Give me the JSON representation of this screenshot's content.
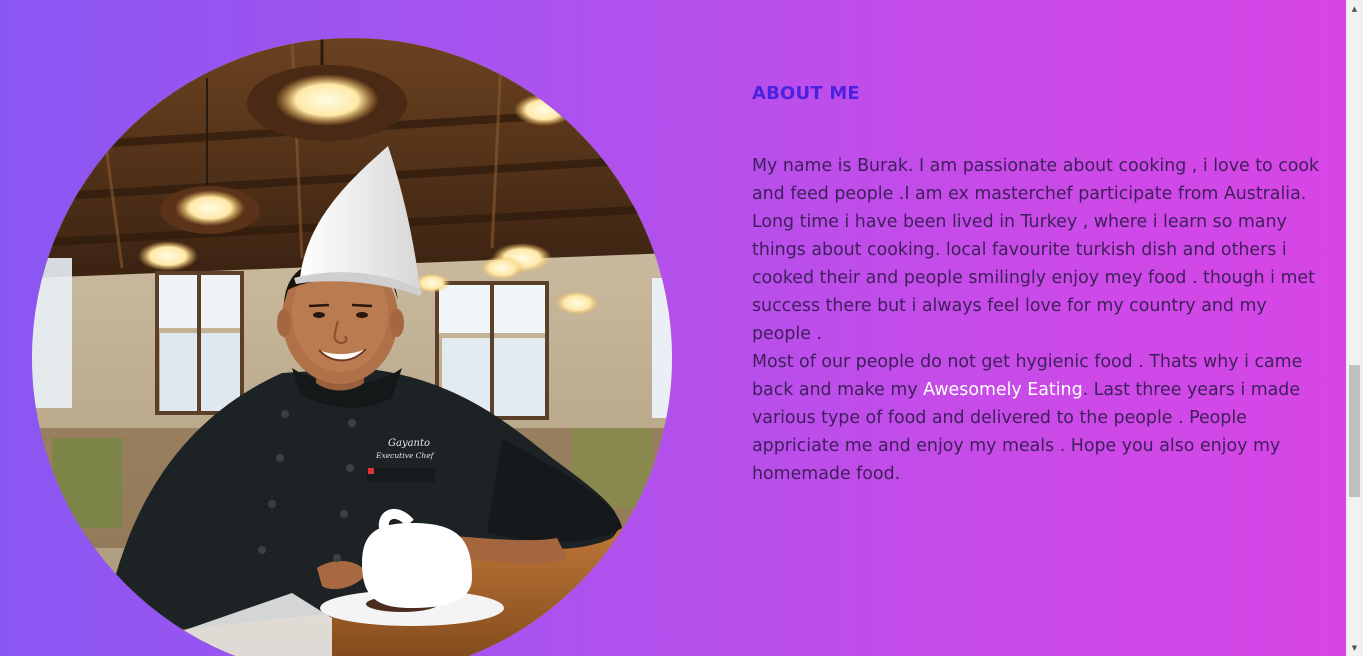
{
  "about": {
    "title": "ABOUT ME",
    "paragraph1": "My name is Burak. I am passionate about cooking , i love to cook and feed people .I am ex masterchef participate from Australia. Long time i have been lived in Turkey , where i learn so many things about cooking. local favourite turkish dish and others i cooked their and people smilingly enjoy mey food . though i met success there but i always feel love for my country and my people .",
    "paragraph2_before": "Most of our people do not get hygienic food . Thats why i came back and make my ",
    "brand": "Awesomely Eating",
    "paragraph2_after": ". Last three years i made various type of food and delivered to the people . People appriciate me and enjoy my meals . Hope you also enjoy my homemade food."
  },
  "photo": {
    "subject": "chef portrait",
    "jacket_embroidery_line1": "Gayanto",
    "jacket_embroidery_line2": "Executive Chef"
  },
  "colors": {
    "gradient_start": "#8a56f2",
    "gradient_end": "#d845e6",
    "title": "#4b22e0",
    "body_text": "#3d1f5a",
    "highlight": "#ffffff"
  },
  "scrollbar": {
    "up_icon": "triangle-up-icon",
    "down_icon": "triangle-down-icon"
  }
}
